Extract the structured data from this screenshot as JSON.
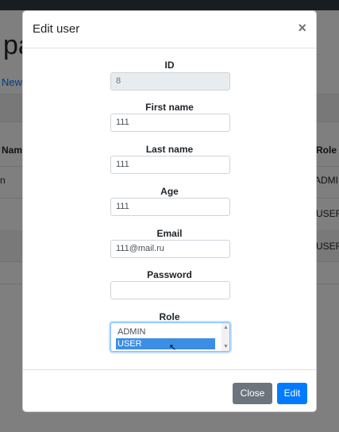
{
  "background": {
    "title_fragment": "pa",
    "link_fragment": "New",
    "col_name_fragment": "Nam",
    "col_role_fragment": "Role",
    "row1_name_fragment": "n",
    "row1_role_fragment": "ADMI",
    "row2_role_fragment": "USER",
    "row3_role_fragment": "USER"
  },
  "modal": {
    "title": "Edit user",
    "close_symbol": "×",
    "fields": {
      "id": {
        "label": "ID",
        "value": "8"
      },
      "first_name": {
        "label": "First name",
        "value": "111"
      },
      "last_name": {
        "label": "Last name",
        "value": "111"
      },
      "age": {
        "label": "Age",
        "value": "111"
      },
      "email": {
        "label": "Email",
        "value": "111@mail.ru"
      },
      "password": {
        "label": "Password",
        "value": ""
      },
      "role": {
        "label": "Role",
        "options": [
          "ADMIN",
          "USER"
        ],
        "selected": "USER"
      }
    },
    "footer": {
      "close_label": "Close",
      "edit_label": "Edit"
    }
  },
  "colors": {
    "primary": "#007bff",
    "secondary": "#6c757d",
    "selected_option": "#3a8ee6"
  }
}
